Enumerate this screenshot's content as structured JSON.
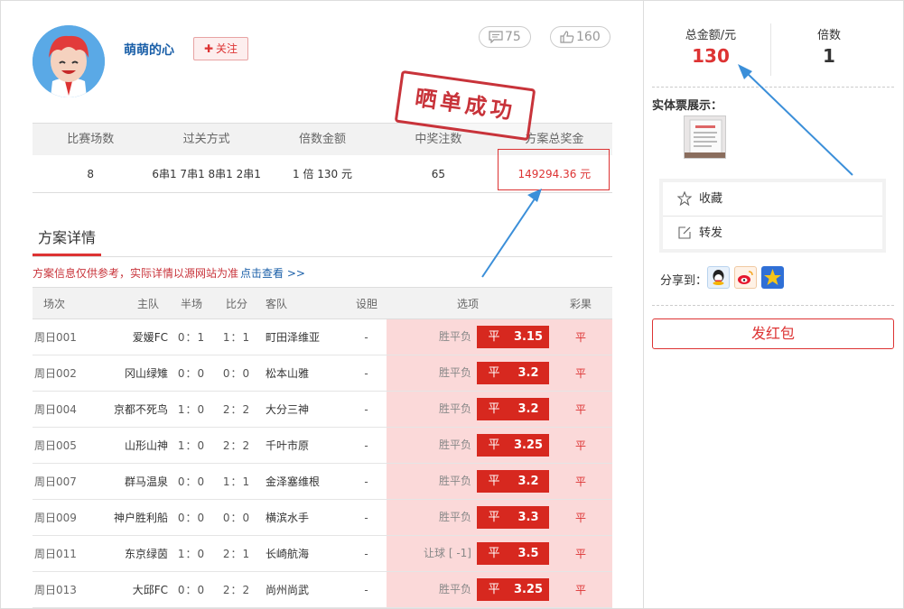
{
  "profile": {
    "username": "萌萌的心",
    "follow_label": "关注",
    "comments": "75",
    "likes": "160"
  },
  "stamp_text": "晒单成功",
  "summary": {
    "headers": [
      "比赛场数",
      "过关方式",
      "倍数金额",
      "中奖注数",
      "方案总奖金"
    ],
    "values": [
      "8",
      "6串1 7串1 8串1 2串1",
      "1 倍  130 元",
      "65",
      "149294.36 元"
    ]
  },
  "tab_label": "方案详情",
  "notice": {
    "text": "方案信息仅供参考，实际详情以源网站为准",
    "link": "点击查看 >>"
  },
  "table": {
    "headers": [
      "场次",
      "主队",
      "半场",
      "比分",
      "客队",
      "设胆",
      "选项",
      "彩果"
    ],
    "rows": [
      {
        "week": "周日001",
        "home": "爱媛FC",
        "half": "0：1",
        "score": "1：1",
        "away": "町田泽维亚",
        "banker": "-",
        "ptype": "胜平负",
        "pick": "平",
        "odd": "3.15",
        "result": "平"
      },
      {
        "week": "周日002",
        "home": "冈山绿雉",
        "half": "0：0",
        "score": "0：0",
        "away": "松本山雅",
        "banker": "-",
        "ptype": "胜平负",
        "pick": "平",
        "odd": "3.2",
        "result": "平"
      },
      {
        "week": "周日004",
        "home": "京都不死鸟",
        "half": "1：0",
        "score": "2：2",
        "away": "大分三神",
        "banker": "-",
        "ptype": "胜平负",
        "pick": "平",
        "odd": "3.2",
        "result": "平"
      },
      {
        "week": "周日005",
        "home": "山形山神",
        "half": "1：0",
        "score": "2：2",
        "away": "千叶市原",
        "banker": "-",
        "ptype": "胜平负",
        "pick": "平",
        "odd": "3.25",
        "result": "平"
      },
      {
        "week": "周日007",
        "home": "群马温泉",
        "half": "0：0",
        "score": "1：1",
        "away": "金泽塞维根",
        "banker": "-",
        "ptype": "胜平负",
        "pick": "平",
        "odd": "3.2",
        "result": "平"
      },
      {
        "week": "周日009",
        "home": "神户胜利船",
        "half": "0：0",
        "score": "0：0",
        "away": "横滨水手",
        "banker": "-",
        "ptype": "胜平负",
        "pick": "平",
        "odd": "3.3",
        "result": "平"
      },
      {
        "week": "周日011",
        "home": "东京绿茵",
        "half": "1：0",
        "score": "2：1",
        "away": "长崎航海",
        "banker": "-",
        "ptype": "让球 [ -1]",
        "pick": "平",
        "odd": "3.5",
        "result": "平"
      },
      {
        "week": "周日013",
        "home": "大邱FC",
        "half": "0：0",
        "score": "2：2",
        "away": "尚州尚武",
        "banker": "-",
        "ptype": "胜平负",
        "pick": "平",
        "odd": "3.25",
        "result": "平"
      }
    ]
  },
  "sidebar": {
    "total_label": "总金额/元",
    "total_value": "130",
    "multiple_label": "倍数",
    "multiple_value": "1",
    "ticket_label": "实体票展示：",
    "actions": [
      "收藏",
      "转发"
    ],
    "share_label": "分享到：",
    "share_targets": [
      "qq-icon",
      "weibo-icon",
      "qzone-star-icon"
    ],
    "redpack_label": "发红包"
  },
  "colors": {
    "accent": "#d33333",
    "link": "#1a5fa8",
    "option_bg": "#fbd9d9",
    "odd_bg": "#d7281f",
    "arrow": "#3b8fd9"
  }
}
